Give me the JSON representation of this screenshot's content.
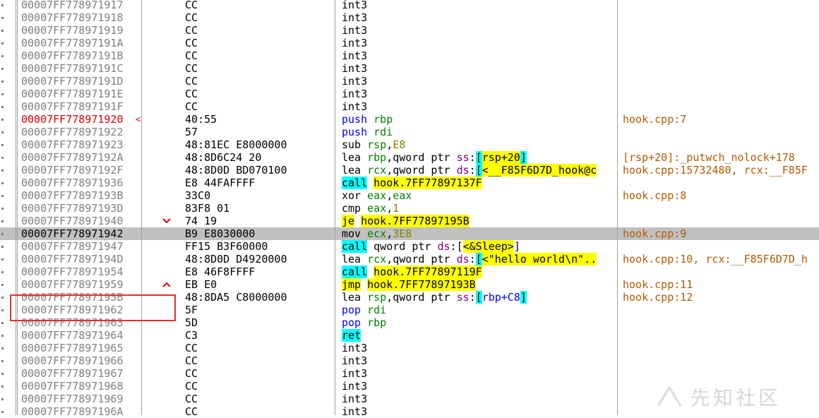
{
  "rows": [
    {
      "addr": "00007FF778971917",
      "bytes": "CC",
      "asm": [
        {
          "t": "int3",
          "c": "mn"
        }
      ],
      "cmt": ""
    },
    {
      "addr": "00007FF778971918",
      "bytes": "CC",
      "asm": [
        {
          "t": "int3",
          "c": "mn"
        }
      ],
      "cmt": ""
    },
    {
      "addr": "00007FF778971919",
      "bytes": "CC",
      "asm": [
        {
          "t": "int3",
          "c": "mn"
        }
      ],
      "cmt": ""
    },
    {
      "addr": "00007FF77897191A",
      "bytes": "CC",
      "asm": [
        {
          "t": "int3",
          "c": "mn"
        }
      ],
      "cmt": ""
    },
    {
      "addr": "00007FF77897191B",
      "bytes": "CC",
      "asm": [
        {
          "t": "int3",
          "c": "mn"
        }
      ],
      "cmt": ""
    },
    {
      "addr": "00007FF77897191C",
      "bytes": "CC",
      "asm": [
        {
          "t": "int3",
          "c": "mn"
        }
      ],
      "cmt": ""
    },
    {
      "addr": "00007FF77897191D",
      "bytes": "CC",
      "asm": [
        {
          "t": "int3",
          "c": "mn"
        }
      ],
      "cmt": ""
    },
    {
      "addr": "00007FF77897191E",
      "bytes": "CC",
      "asm": [
        {
          "t": "int3",
          "c": "mn"
        }
      ],
      "cmt": ""
    },
    {
      "addr": "00007FF77897191F",
      "bytes": "CC",
      "asm": [
        {
          "t": "int3",
          "c": "mn"
        }
      ],
      "cmt": ""
    },
    {
      "addr": "00007FF778971920",
      "bytes": "40:55",
      "current": true,
      "mark": "<",
      "asm": [
        {
          "t": "push",
          "c": "mn push"
        },
        {
          "t": " "
        },
        {
          "t": "rbp",
          "c": "reg"
        }
      ],
      "cmt": "hook.cpp:7"
    },
    {
      "addr": "00007FF778971922",
      "bytes": "57",
      "asm": [
        {
          "t": "push",
          "c": "mn push"
        },
        {
          "t": " "
        },
        {
          "t": "rdi",
          "c": "reg"
        }
      ],
      "cmt": ""
    },
    {
      "addr": "00007FF778971923",
      "bytes": "48:81EC E8000000",
      "asm": [
        {
          "t": "sub",
          "c": "mn"
        },
        {
          "t": " "
        },
        {
          "t": "rsp",
          "c": "reg"
        },
        {
          "t": ","
        },
        {
          "t": "E8",
          "c": "num"
        }
      ],
      "cmt": ""
    },
    {
      "addr": "00007FF77897192A",
      "bytes": "48:8D6C24 20",
      "asm": [
        {
          "t": "lea",
          "c": "mn"
        },
        {
          "t": " "
        },
        {
          "t": "rbp",
          "c": "reg"
        },
        {
          "t": ","
        },
        {
          "t": "qword ptr",
          "c": "kw"
        },
        {
          "t": " "
        },
        {
          "t": "ss",
          "c": "seg"
        },
        {
          "t": ":"
        },
        {
          "t": "[",
          "c": "hlc"
        },
        {
          "t": "rsp+20",
          "c": "hly"
        },
        {
          "t": "]",
          "c": "hlc"
        }
      ],
      "cmt": "[rsp+20]:_putwch_nolock+178"
    },
    {
      "addr": "00007FF77897192F",
      "bytes": "48:8D0D BD070100",
      "asm": [
        {
          "t": "lea",
          "c": "mn"
        },
        {
          "t": " "
        },
        {
          "t": "rcx",
          "c": "reg"
        },
        {
          "t": ","
        },
        {
          "t": "qword ptr",
          "c": "kw"
        },
        {
          "t": " "
        },
        {
          "t": "ds",
          "c": "seg"
        },
        {
          "t": ":"
        },
        {
          "t": "[",
          "c": "hlc"
        },
        {
          "t": "<__F85F6D7D_hook@c",
          "c": "hly"
        }
      ],
      "cmt": "hook.cpp:15732480, rcx:__F85F"
    },
    {
      "addr": "00007FF778971936",
      "bytes": "E8 44FAFFFF",
      "asm": [
        {
          "t": "call",
          "c": "hlc"
        },
        {
          "t": " "
        },
        {
          "t": "hook.7FF77897137F",
          "c": "hly"
        }
      ],
      "cmt": ""
    },
    {
      "addr": "00007FF77897193B",
      "bytes": "33C0",
      "asm": [
        {
          "t": "xor",
          "c": "mn"
        },
        {
          "t": " "
        },
        {
          "t": "eax",
          "c": "reg"
        },
        {
          "t": ","
        },
        {
          "t": "eax",
          "c": "reg"
        }
      ],
      "cmt": "hook.cpp:8"
    },
    {
      "addr": "00007FF77897193D",
      "bytes": "83F8 01",
      "asm": [
        {
          "t": "cmp",
          "c": "mn"
        },
        {
          "t": " "
        },
        {
          "t": "eax",
          "c": "reg"
        },
        {
          "t": ","
        },
        {
          "t": "1",
          "c": "num"
        }
      ],
      "cmt": ""
    },
    {
      "addr": "00007FF778971940",
      "bytes": "74 19",
      "arrow": "down",
      "asm": [
        {
          "t": "je",
          "c": "hly"
        },
        {
          "t": " "
        },
        {
          "t": "hook.7FF77897195B",
          "c": "hly"
        }
      ],
      "cmt": ""
    },
    {
      "addr": "00007FF778971942",
      "bytes": "B9 E8030000",
      "selected": true,
      "asm": [
        {
          "t": "mov",
          "c": "mn"
        },
        {
          "t": " "
        },
        {
          "t": "ecx",
          "c": "reg"
        },
        {
          "t": ","
        },
        {
          "t": "3E8",
          "c": "num"
        }
      ],
      "cmt": "hook.cpp:9"
    },
    {
      "addr": "00007FF778971947",
      "bytes": "FF15 B3F60000",
      "asm": [
        {
          "t": "call",
          "c": "hlc"
        },
        {
          "t": " "
        },
        {
          "t": "qword ptr",
          "c": "kw"
        },
        {
          "t": " "
        },
        {
          "t": "ds",
          "c": "seg"
        },
        {
          "t": ":"
        },
        {
          "t": "[",
          "c": "op"
        },
        {
          "t": "<&Sleep>",
          "c": "hly"
        },
        {
          "t": "]",
          "c": "op"
        }
      ],
      "cmt": ""
    },
    {
      "addr": "00007FF77897194D",
      "bytes": "48:8D0D D4920000",
      "asm": [
        {
          "t": "lea",
          "c": "mn"
        },
        {
          "t": " "
        },
        {
          "t": "rcx",
          "c": "reg"
        },
        {
          "t": ","
        },
        {
          "t": "qword ptr",
          "c": "kw"
        },
        {
          "t": " "
        },
        {
          "t": "ds",
          "c": "seg"
        },
        {
          "t": ":"
        },
        {
          "t": "[",
          "c": "hlc"
        },
        {
          "t": "<\"hello world\\n\"..",
          "c": "hly"
        }
      ],
      "cmt": "hook.cpp:10, rcx:__F85F6D7D_h"
    },
    {
      "addr": "00007FF778971954",
      "bytes": "E8 46F8FFFF",
      "asm": [
        {
          "t": "call",
          "c": "hlc"
        },
        {
          "t": " "
        },
        {
          "t": "hook.7FF77897119F",
          "c": "hly"
        }
      ],
      "cmt": ""
    },
    {
      "addr": "00007FF778971959",
      "bytes": "EB E0",
      "arrow": "up",
      "asm": [
        {
          "t": "jmp",
          "c": "hly"
        },
        {
          "t": " "
        },
        {
          "t": "hook.7FF77897193B",
          "c": "hly"
        }
      ],
      "cmt": "hook.cpp:11"
    },
    {
      "addr": "00007FF77897195B",
      "bytes": "48:8DA5 C8000000",
      "asm": [
        {
          "t": "lea",
          "c": "mn"
        },
        {
          "t": " "
        },
        {
          "t": "rsp",
          "c": "reg"
        },
        {
          "t": ","
        },
        {
          "t": "qword ptr",
          "c": "kw"
        },
        {
          "t": " "
        },
        {
          "t": "ss",
          "c": "seg"
        },
        {
          "t": ":"
        },
        {
          "t": "[",
          "c": "hlc"
        },
        {
          "t": "rbp+C8",
          "c": "mem"
        },
        {
          "t": "]",
          "c": "hlc"
        }
      ],
      "cmt": "hook.cpp:12"
    },
    {
      "addr": "00007FF778971962",
      "bytes": "5F",
      "asm": [
        {
          "t": "pop",
          "c": "mn pop"
        },
        {
          "t": " "
        },
        {
          "t": "rdi",
          "c": "reg"
        }
      ],
      "cmt": ""
    },
    {
      "addr": "00007FF778971963",
      "bytes": "5D",
      "asm": [
        {
          "t": "pop",
          "c": "mn pop"
        },
        {
          "t": " "
        },
        {
          "t": "rbp",
          "c": "reg"
        }
      ],
      "cmt": ""
    },
    {
      "addr": "00007FF778971964",
      "bytes": "C3",
      "asm": [
        {
          "t": "ret",
          "c": "hlc"
        }
      ],
      "cmt": ""
    },
    {
      "addr": "00007FF778971965",
      "bytes": "CC",
      "asm": [
        {
          "t": "int3",
          "c": "mn"
        }
      ],
      "cmt": ""
    },
    {
      "addr": "00007FF778971966",
      "bytes": "CC",
      "asm": [
        {
          "t": "int3",
          "c": "mn"
        }
      ],
      "cmt": ""
    },
    {
      "addr": "00007FF778971967",
      "bytes": "CC",
      "asm": [
        {
          "t": "int3",
          "c": "mn"
        }
      ],
      "cmt": ""
    },
    {
      "addr": "00007FF778971968",
      "bytes": "CC",
      "asm": [
        {
          "t": "int3",
          "c": "mn"
        }
      ],
      "cmt": ""
    },
    {
      "addr": "00007FF778971969",
      "bytes": "CC",
      "asm": [
        {
          "t": "int3",
          "c": "mn"
        }
      ],
      "cmt": ""
    },
    {
      "addr": "00007FF77897196A",
      "bytes": "CC",
      "asm": [
        {
          "t": "int3",
          "c": "mn"
        }
      ],
      "cmt": ""
    }
  ],
  "watermark": "先知社区",
  "colors": {
    "address": "#808080",
    "current_address": "#e00000",
    "selected_row": "#c0c0c0",
    "comment": "#b05a00",
    "register": "#008000",
    "number": "#808000",
    "segment": "#800080",
    "cyan_highlight": "#00ffff",
    "yellow_highlight": "#ffff00",
    "annotation_box": "#e03030"
  }
}
